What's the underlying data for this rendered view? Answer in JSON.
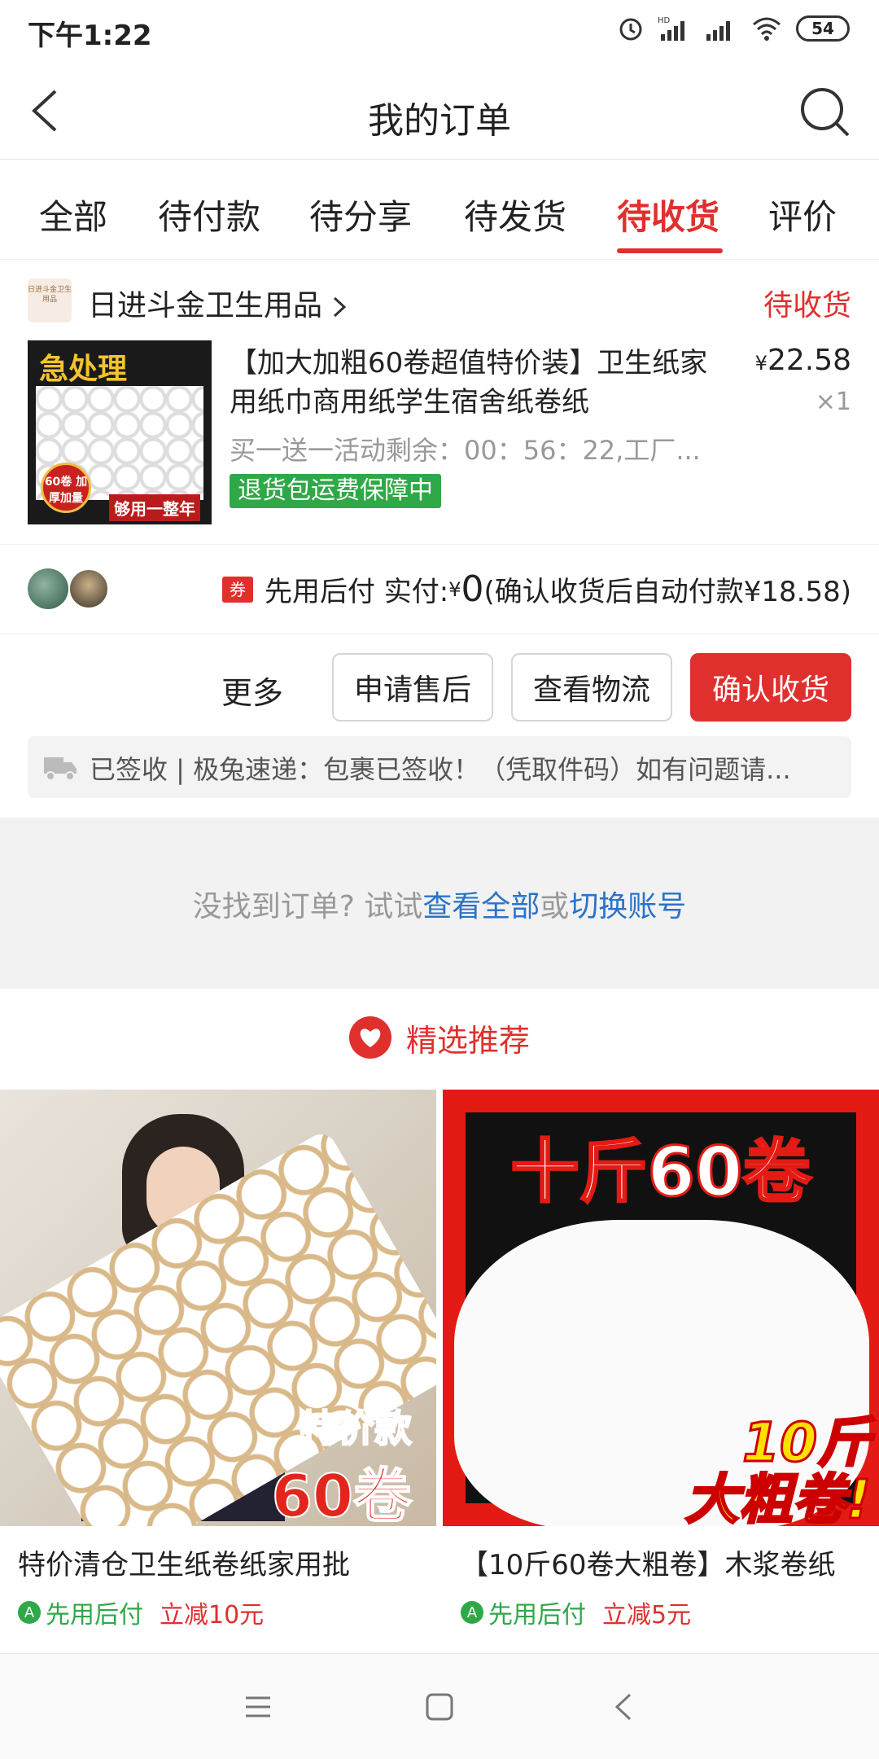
{
  "status_bar": {
    "time": "下午1:22",
    "battery": "54",
    "icons": [
      "alarm-icon",
      "hd-signal-icon",
      "signal-icon",
      "wifi-icon",
      "battery-icon"
    ]
  },
  "header": {
    "title": "我的订单",
    "back_icon": "chevron-left-icon",
    "search_icon": "search-icon"
  },
  "tabs": [
    {
      "label": "全部"
    },
    {
      "label": "待付款"
    },
    {
      "label": "待分享"
    },
    {
      "label": "待发货"
    },
    {
      "label": "待收货",
      "active": true
    },
    {
      "label": "评价"
    }
  ],
  "order": {
    "store_name": "日进斗金卫生用品",
    "store_logo_text": "日进斗金卫生用品",
    "status": "待收货",
    "product_image_banner": "急处理",
    "product_image_seal": "60卷 加厚加量",
    "product_image_caption": "够用一整年",
    "product_title": "【加大加粗60卷超值特价装】卫生纸家用纸巾商用纸学生宿舍纸卷纸",
    "price_symbol": "¥",
    "price": "22.58",
    "quantity": "×1",
    "promo": "买一送一活动剩余：00：56：22,工厂...",
    "badge": "退货包运费保障中",
    "coupon_label": "券",
    "pay_label": "先用后付 实付: ",
    "pay_yen": "¥",
    "pay_amount": "0",
    "pay_note": "(确认收货后自动付款¥18.58)",
    "more": "更多",
    "buttons": {
      "after_sale": "申请售后",
      "logistics": "查看物流",
      "confirm": "确认收货"
    },
    "logistics_text": "已签收 | 极兔速递：包裹已签收！（凭取件码）如有问题请..."
  },
  "not_found": {
    "prefix": "没找到订单? 试试",
    "link_all": "查看全部",
    "or": "或",
    "link_switch": "切换账号"
  },
  "recommend": {
    "title": "精选推荐",
    "items": [
      {
        "image_tag_1": "特价款",
        "image_tag_2": "60卷",
        "title": "特价清仓卫生纸卷纸家用批",
        "pay_label": "先用后付",
        "discount": "立减10元"
      },
      {
        "image_headline": "十斤60卷",
        "image_tag_1": "10斤",
        "image_tag_2": "大粗卷!",
        "title": "【10斤60卷大粗卷】木浆卷纸",
        "pay_label": "先用后付",
        "discount": "立减5元"
      }
    ]
  },
  "colors": {
    "accent": "#e0302e",
    "green": "#2fa847",
    "link": "#2a73c9"
  }
}
